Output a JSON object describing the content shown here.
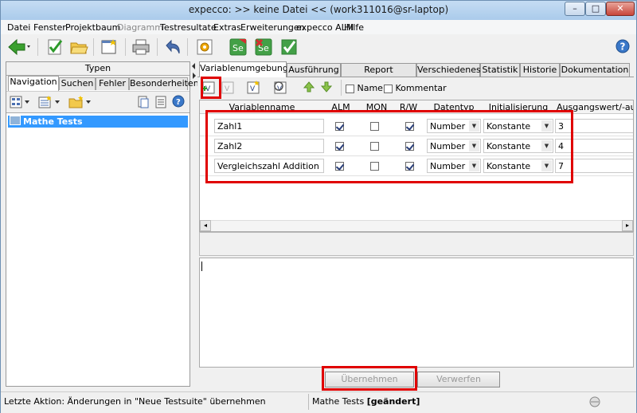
{
  "window": {
    "title": "expecco: >> keine Datei << (work311016@sr-laptop)",
    "min_label": "–",
    "max_label": "□",
    "close_label": "✕"
  },
  "menu": {
    "items": [
      {
        "label": "Datei"
      },
      {
        "label": "Fenster"
      },
      {
        "label": "Projektbaum"
      },
      {
        "label": "Diagramm"
      },
      {
        "label": "Testresultate"
      },
      {
        "label": "Extras"
      },
      {
        "label": "Erweiterungen"
      },
      {
        "label": "expecco ALM"
      },
      {
        "label": "Hilfe"
      }
    ]
  },
  "left_panel": {
    "top_tab": "Typen",
    "tabs": [
      "Navigation",
      "Suchen",
      "Fehler",
      "Besonderheiten"
    ],
    "tree": {
      "root": "Mathe Tests"
    }
  },
  "right_panel": {
    "tabs": [
      "Variablenumgebung",
      "Ausführung",
      "Report Parameter",
      "Verschiedenes",
      "Statistik",
      "Historie",
      "Dokumentation"
    ],
    "filter_name_label": "Name",
    "filter_comment_label": "Kommentar",
    "table": {
      "headers": [
        "Variablenname",
        "ALM",
        "MON",
        "R/W",
        "Datentyp",
        "Initialisierung",
        "Ausgangswert/-ausd"
      ],
      "rows": [
        {
          "name": "Zahl1",
          "alm": true,
          "mon": false,
          "rw": true,
          "type": "Number",
          "init": "Konstante",
          "value": "3"
        },
        {
          "name": "Zahl2",
          "alm": true,
          "mon": false,
          "rw": true,
          "type": "Number",
          "init": "Konstante",
          "value": "4"
        },
        {
          "name": "Vergleichszahl Addition",
          "alm": true,
          "mon": false,
          "rw": true,
          "type": "Number",
          "init": "Konstante",
          "value": "7"
        }
      ]
    },
    "apply_label": "Übernehmen",
    "discard_label": "Verwerfen"
  },
  "status": {
    "left": "Letzte Aktion: Änderungen in \"Neue Testsuite\" übernehmen",
    "right_name": "Mathe Tests",
    "right_state": "[geändert]"
  },
  "colors": {
    "highlight": "#e00000",
    "selection": "#3399ff"
  },
  "icons": [
    "back-arrow-icon",
    "checkmark-icon",
    "open-folder-icon",
    "new-window-icon",
    "printer-icon",
    "undo-arrow-icon",
    "settings-icon",
    "selenium-icon",
    "selenium-remove-icon",
    "help-icon",
    "add-variable-icon",
    "arrow-up-icon",
    "arrow-down-icon"
  ]
}
